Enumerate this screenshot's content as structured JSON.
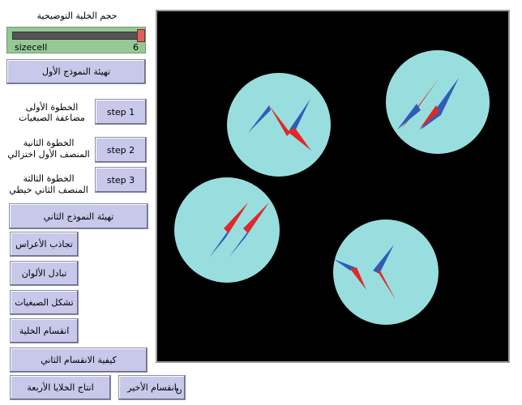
{
  "slider": {
    "title": "حجم الخلية التوضيحية",
    "name": "sizecell",
    "value": "6",
    "level_fraction": 0.98
  },
  "buttons": {
    "setup1": "تهيئة النموذج الأول",
    "step1": "step 1",
    "step2": "step 2",
    "step3": "step 3",
    "setup2": "تهيئة النموذج الثاني",
    "attract": "تجاذب الأعراس",
    "exchange": "تبادل الألوان",
    "chromosomes": "تشكل الصبغيات",
    "division": "انقسام الخلية",
    "second_division": "كيفية الانقسام الثاني",
    "four_cells": "انتاج الخلايا الأربعة",
    "last_division": "انقسام الأخير"
  },
  "labels": {
    "step1_l1": "الخطوة الأولى",
    "step1_l2": "مضاعفة الصبغيات",
    "step2_l1": "الخطوة الثانية",
    "step2_l2": "المنصف الأول اختزالي",
    "step3_l1": "الخطوة الثالثة",
    "step3_l2": "المنصف الثاني خيطي"
  },
  "colors": {
    "cell": "#99dede",
    "red": "#e02828",
    "blue": "#2f5cb8",
    "background": "#000000"
  }
}
